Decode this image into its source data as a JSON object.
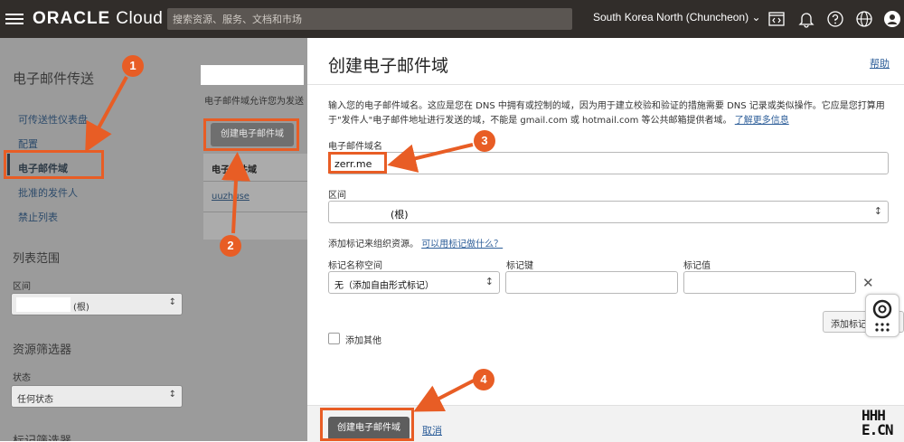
{
  "topbar": {
    "logo_brand": "ORACLE",
    "logo_product": "Cloud",
    "search_placeholder": "搜索资源、服务、文档和市场",
    "region": "South Korea North (Chuncheon)",
    "icons": [
      "menu-icon",
      "code-editor-icon",
      "bell-icon",
      "help-icon",
      "globe-icon",
      "user-icon"
    ]
  },
  "sidebar": {
    "title": "电子邮件传送",
    "items": [
      {
        "label": "可传送性仪表盘"
      },
      {
        "label": "配置"
      },
      {
        "label": "电子邮件域",
        "active": true
      },
      {
        "label": "批准的发件人"
      },
      {
        "label": "禁止列表"
      }
    ],
    "list_scope_title": "列表范围",
    "compartment_label": "区间",
    "compartment_value": "(根)",
    "filters_title": "资源筛选器",
    "state_label": "状态",
    "state_value": "任何状态",
    "tag_filters_title": "标记筛选器"
  },
  "background_list": {
    "description": "电子邮件域允许您为发送",
    "create_button": "创建电子邮件域",
    "column_header": "电子邮件域",
    "row": "uuzhuse"
  },
  "panel": {
    "title": "创建电子邮件域",
    "help": "帮助",
    "description": "输入您的电子邮件域名。这应是您在 DNS 中拥有或控制的域，因为用于建立校验和验证的措施需要 DNS 记录或类似操作。它应是您打算用于\"发件人\"电子邮件地址进行发送的域，不能是 gmail.com 或 hotmail.com 等公共邮箱提供者域。",
    "learn_more": "了解更多信息",
    "domain_label": "电子邮件域名",
    "domain_value": "zerr.me",
    "compartment_label": "区间",
    "compartment_value": "(根)",
    "tags_intro": "添加标记来组织资源。",
    "tags_link": "可以用标记做什么？",
    "tag_namespace_label": "标记名称空间",
    "tag_namespace_value": "无（添加自由形式标记）",
    "tag_key_label": "标记键",
    "tag_value_label": "标记值",
    "add_tag_button": "添加标记",
    "add_other_label": "添加其他",
    "create_button": "创建电子邮件域",
    "cancel_button": "取消"
  },
  "annotations": {
    "steps": [
      "1",
      "2",
      "3",
      "4"
    ],
    "color": "#e85d25"
  },
  "watermark": [
    "HHH",
    "E.CN"
  ]
}
